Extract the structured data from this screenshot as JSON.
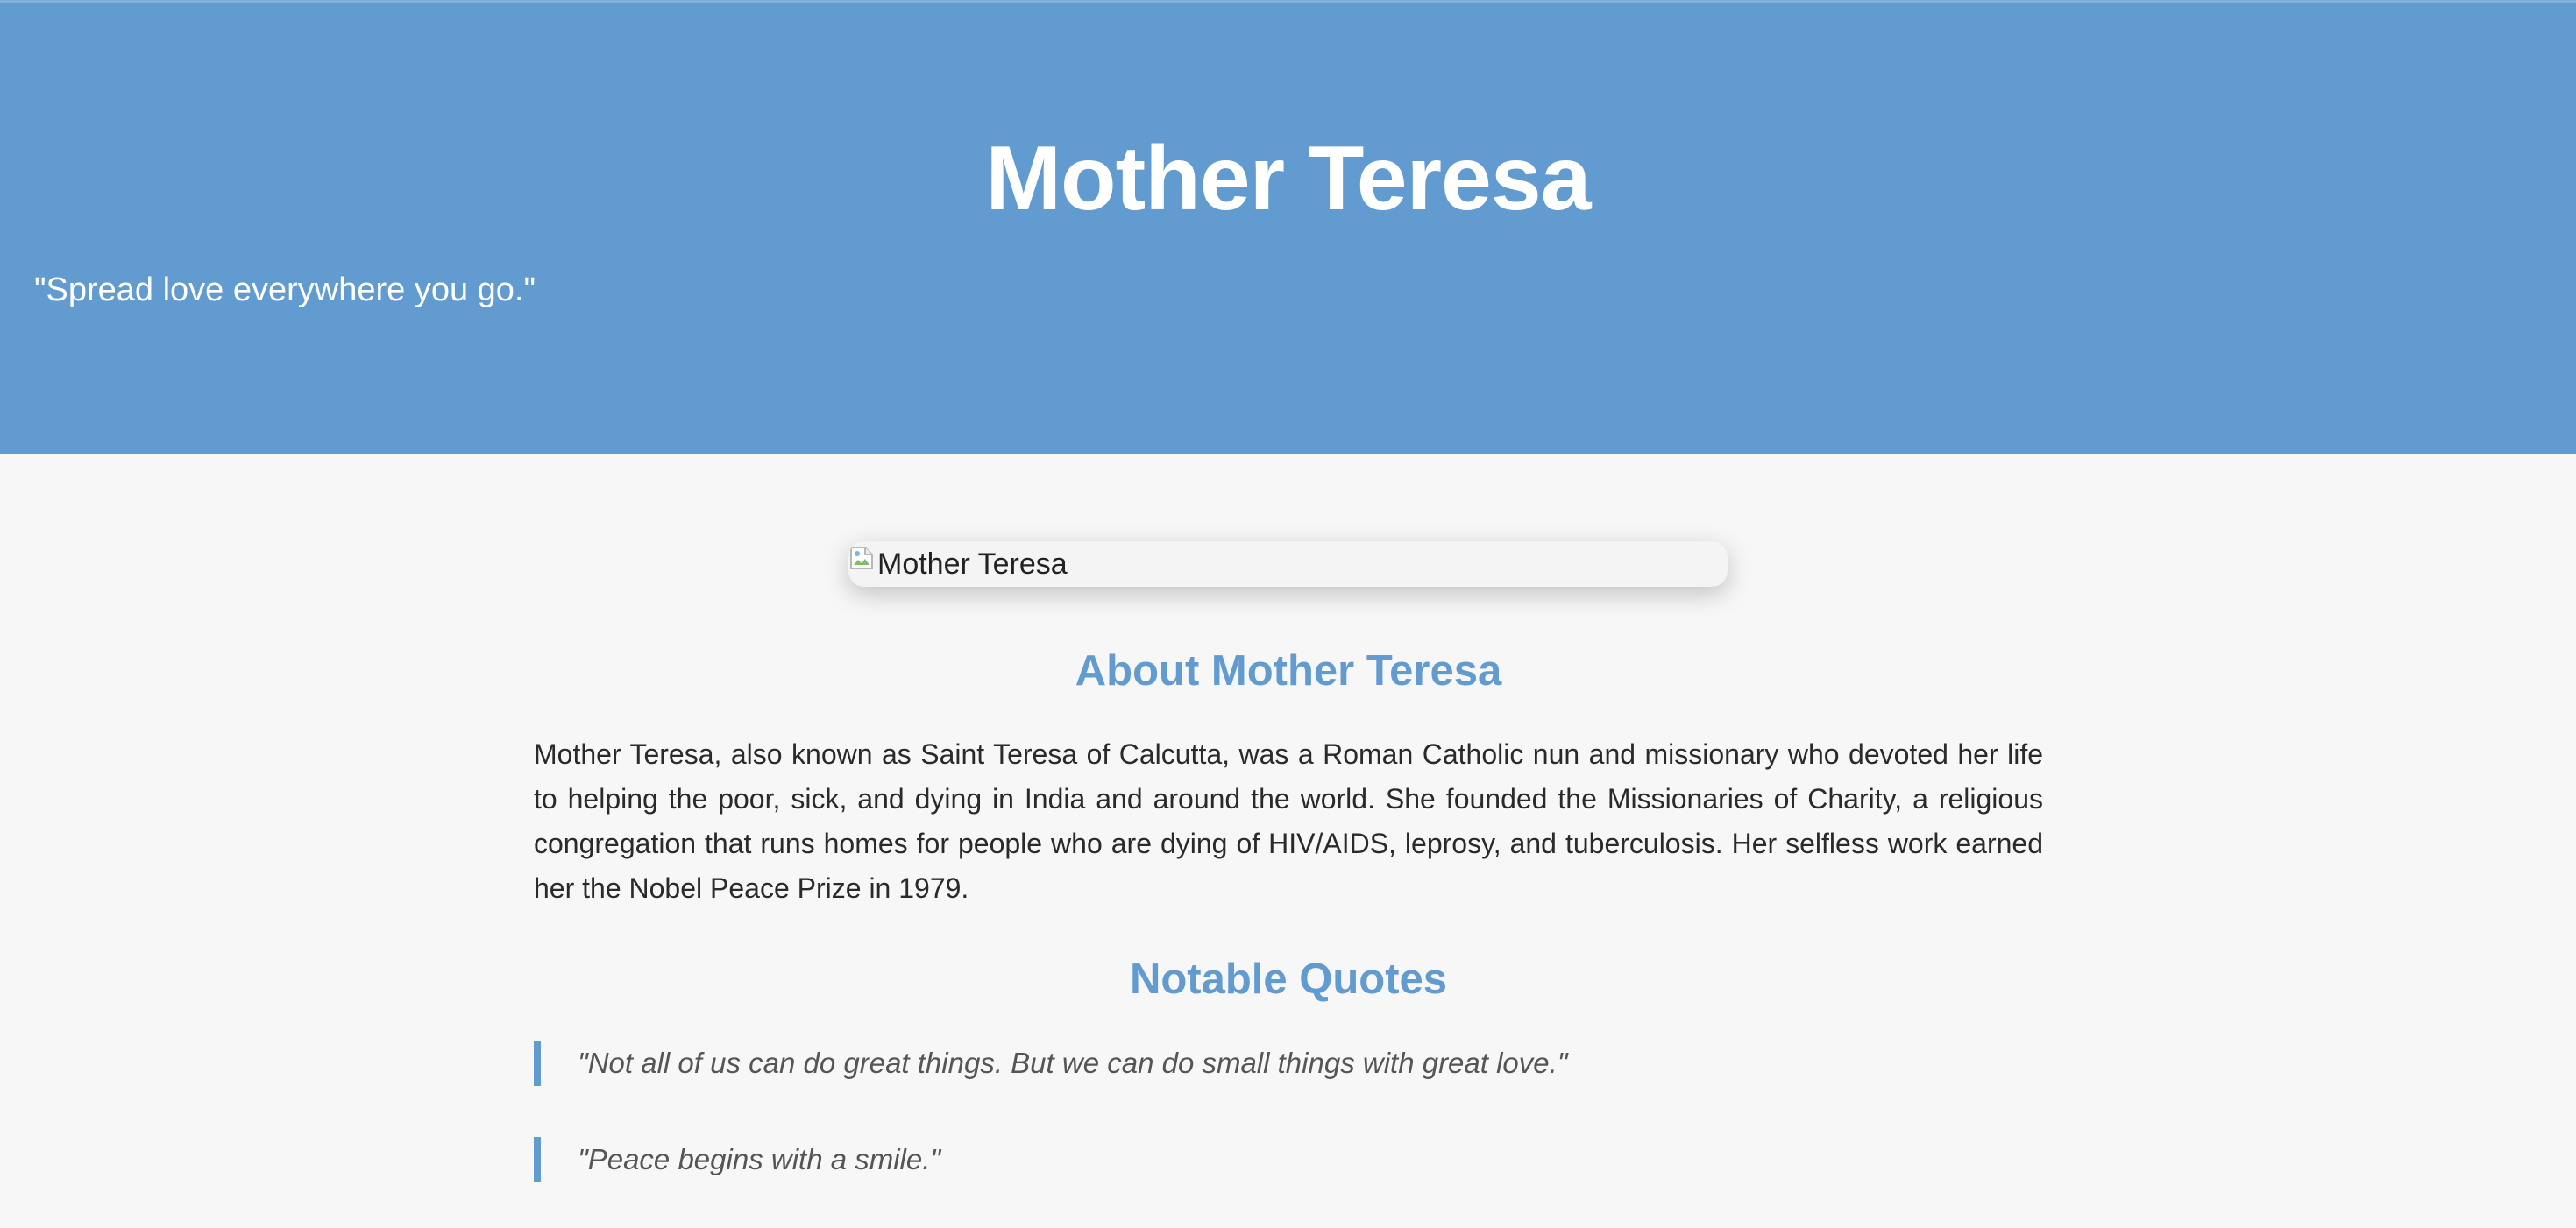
{
  "hero": {
    "title": "Mother Teresa",
    "quote": "\"Spread love everywhere you go.\""
  },
  "portrait": {
    "alt": "Mother Teresa",
    "icon": "broken-image-icon"
  },
  "about": {
    "title": "About Mother Teresa",
    "text": "Mother Teresa, also known as Saint Teresa of Calcutta, was a Roman Catholic nun and missionary who devoted her life to helping the poor, sick, and dying in India and around the world. She founded the Missionaries of Charity, a religious congregation that runs homes for people who are dying of HIV/AIDS, leprosy, and tuberculosis. Her selfless work earned her the Nobel Peace Prize in 1979."
  },
  "quotes": {
    "title": "Notable Quotes",
    "items": [
      "\"Not all of us can do great things. But we can do small things with great love.\"",
      "\"Peace begins with a smile.\""
    ]
  },
  "colors": {
    "accent": "#629bcf",
    "background": "#f7f7f7",
    "text": "#2a2a2a",
    "quote_text": "#555555"
  }
}
